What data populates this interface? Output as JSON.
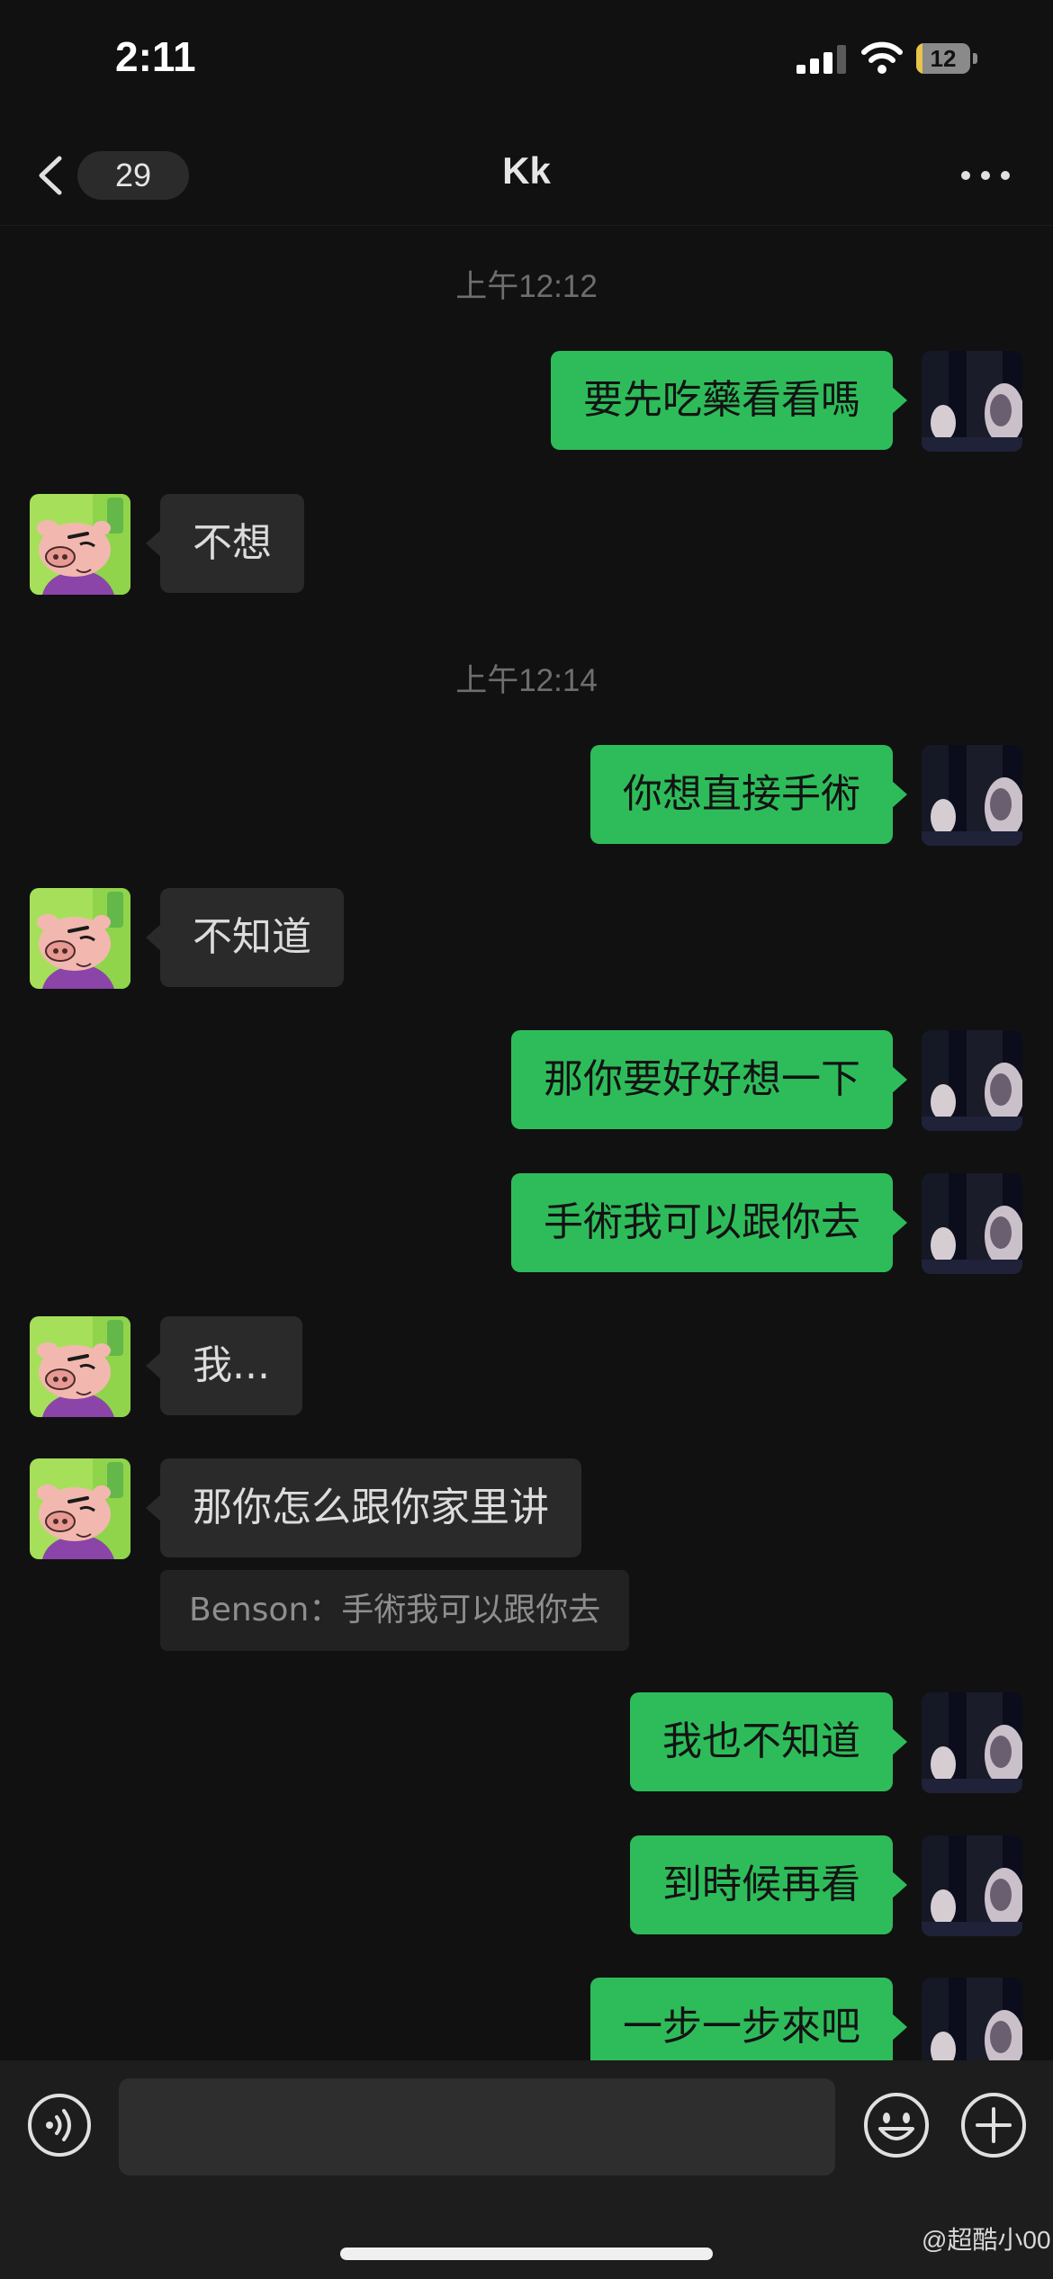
{
  "status_bar": {
    "time": "2:11",
    "battery": "12",
    "battery_level": 0.12
  },
  "nav": {
    "unread_count": "29",
    "title": "Kk"
  },
  "chat": {
    "timestamps": [
      "上午12:12",
      "上午12:14"
    ],
    "messages": [
      {
        "side": "out",
        "text": "要先吃藥看看嗎"
      },
      {
        "side": "in",
        "text": "不想"
      },
      {
        "side": "out",
        "text": "你想直接手術"
      },
      {
        "side": "in",
        "text": "不知道"
      },
      {
        "side": "out",
        "text": "那你要好好想一下"
      },
      {
        "side": "out",
        "text": "手術我可以跟你去"
      },
      {
        "side": "in",
        "text": "我..."
      },
      {
        "side": "in",
        "text": "那你怎么跟你家里讲"
      },
      {
        "side": "out",
        "text": "我也不知道"
      },
      {
        "side": "out",
        "text": "到時候再看"
      },
      {
        "side": "out",
        "text": "一步一步來吧"
      }
    ],
    "quote": "Benson：手術我可以跟你去"
  },
  "input": {
    "placeholder": ""
  },
  "watermark": "@超酷小00",
  "colors": {
    "outgoing_bubble": "#2ebc5a",
    "incoming_bubble": "#2a2a2a",
    "background": "#111111"
  },
  "icons": [
    "back-chevron-icon",
    "more-icon",
    "voice-icon",
    "emoji-icon",
    "plus-icon",
    "pig-avatar-icon"
  ]
}
